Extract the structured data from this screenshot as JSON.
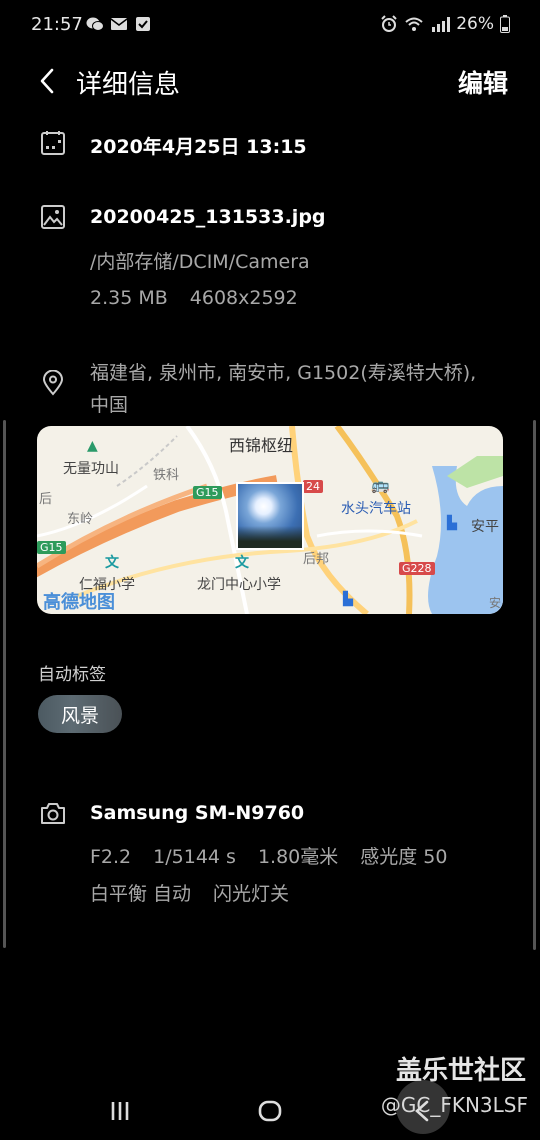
{
  "status_bar": {
    "time": "21:57",
    "battery": "26%"
  },
  "header": {
    "title": "详细信息",
    "edit_label": "编辑"
  },
  "date_row": {
    "datetime": "2020年4月25日 13:15"
  },
  "file_row": {
    "filename": "20200425_131533.jpg",
    "path": "/内部存储/DCIM/Camera",
    "size": "2.35 MB",
    "resolution": "4608x2592"
  },
  "location_row": {
    "address_line1": "福建省, 泉州市, 南安市, G1502(寿溪特大桥),",
    "address_line2": "中国"
  },
  "map": {
    "labels": {
      "xijin": "西锦枢纽",
      "wuxiangong": "无量功山",
      "tieke": "铁科",
      "dongling": "东岭",
      "shuitou": "水头汽车站",
      "anping": "安平",
      "renfu": "仁福小学",
      "longmen": "龙门中心小学",
      "houbang": "后邦",
      "logo": "高德地图",
      "g15_a": "G15",
      "g15_b": "G15",
      "g228": "G228",
      "g24": "24",
      "stray_a": "后",
      "stray_b": "安"
    }
  },
  "auto_tags": {
    "title": "自动标签",
    "tags": [
      "风景"
    ]
  },
  "camera_row": {
    "model": "Samsung SM-N9760",
    "aperture": "F2.2",
    "shutter": "1/5144 s",
    "focal": "1.80毫米",
    "iso": "感光度 50",
    "white_balance": "白平衡 自动",
    "flash": "闪光灯关"
  },
  "watermark": {
    "line1": "盖乐世社区",
    "line2": "@GC_FKN3LSF"
  }
}
